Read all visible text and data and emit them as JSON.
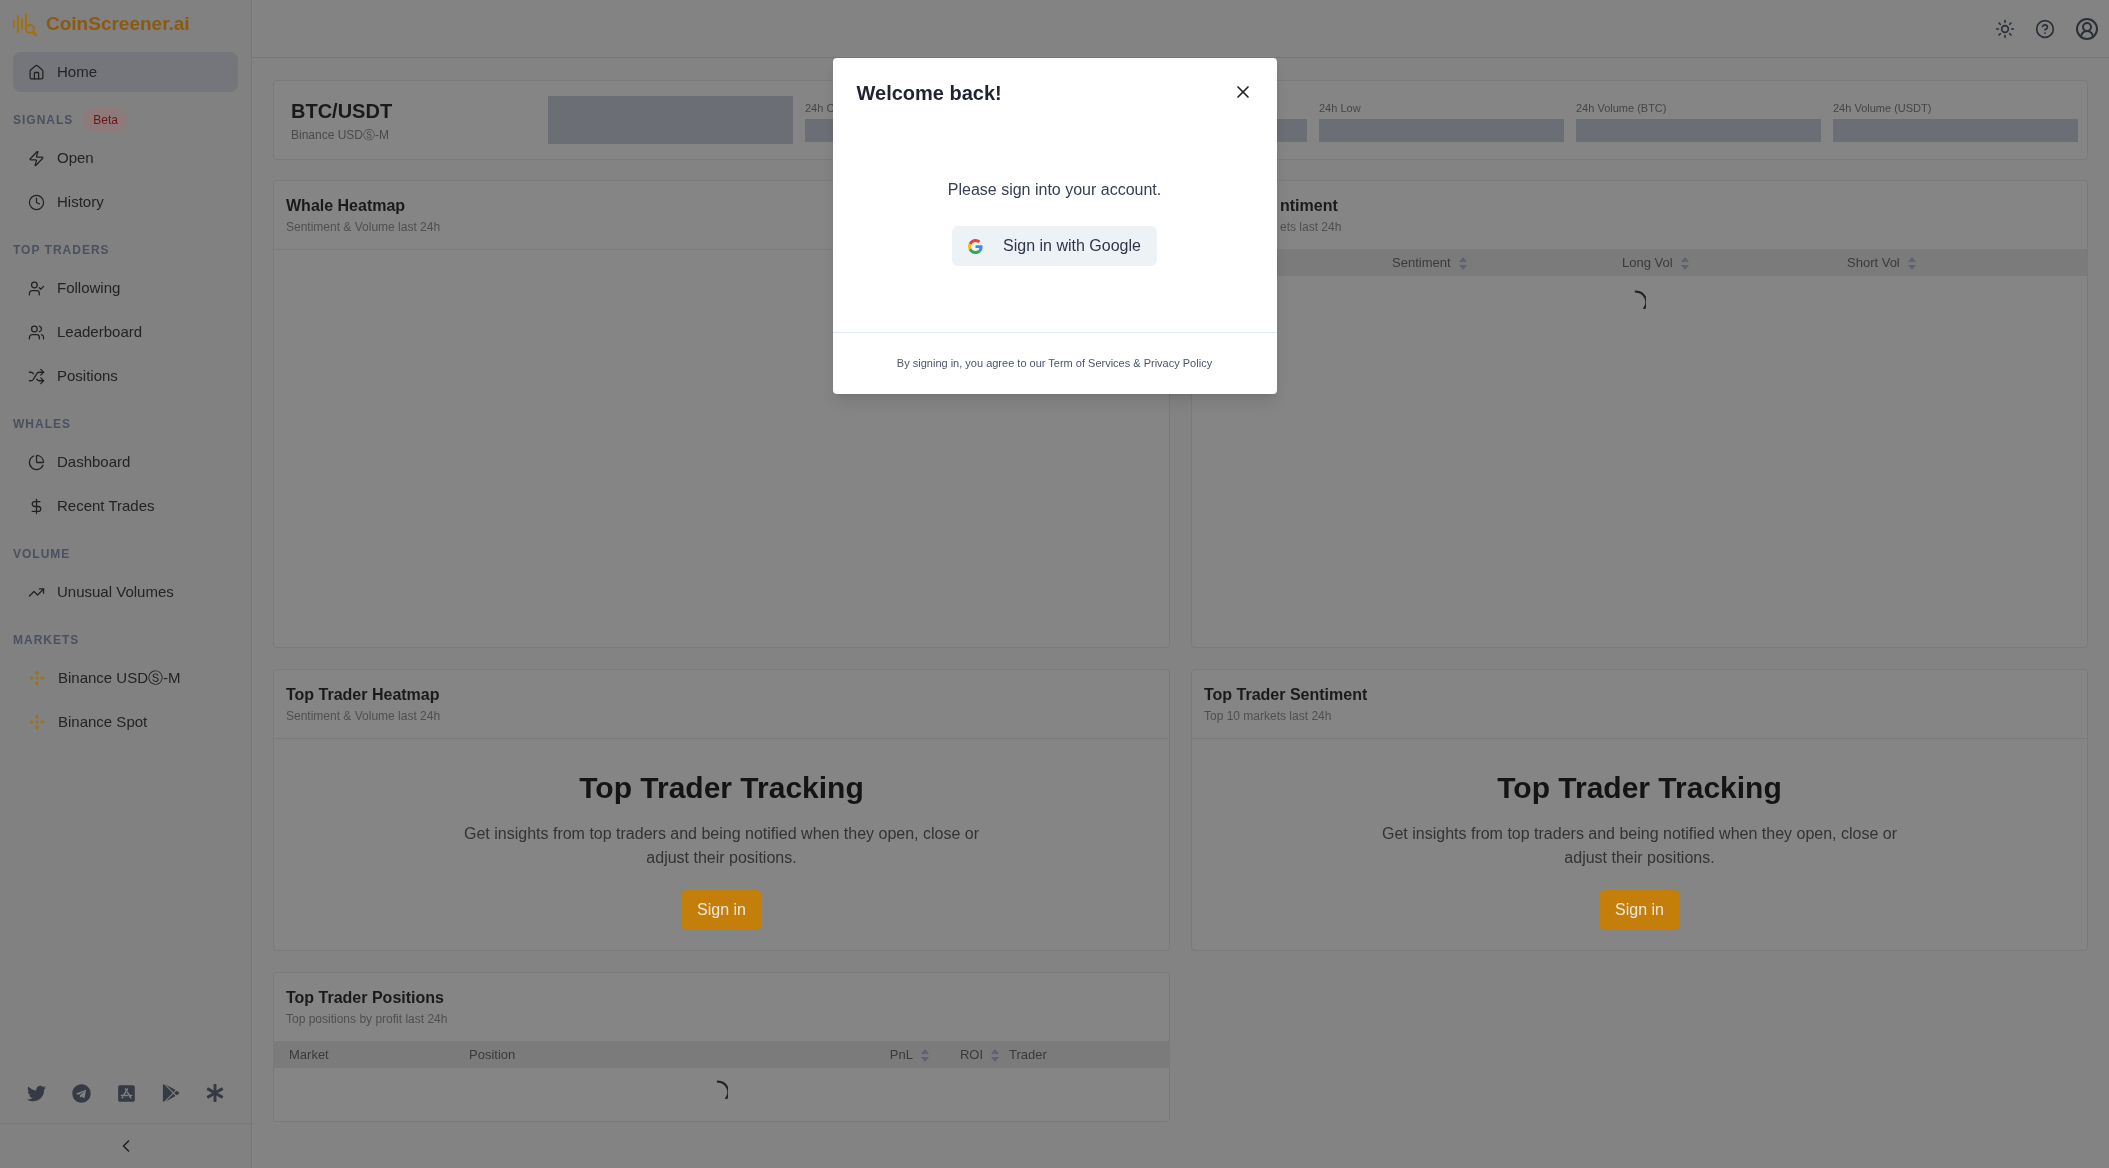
{
  "sidebar": {
    "logo": "CoinScreener.ai",
    "sections": [
      {
        "items": [
          {
            "label": "Home",
            "kind": "home",
            "selected": true
          }
        ]
      },
      {
        "title": "SIGNALS",
        "badge": "Beta",
        "items": [
          {
            "label": "Open",
            "kind": "zap",
            "selected": false
          },
          {
            "label": "History",
            "kind": "clock",
            "selected": false
          }
        ]
      },
      {
        "title": "TOP TRADERS",
        "items": [
          {
            "label": "Following",
            "kind": "user-check",
            "selected": false
          },
          {
            "label": "Leaderboard",
            "kind": "users",
            "selected": false
          },
          {
            "label": "Positions",
            "kind": "shuffle",
            "selected": false
          }
        ]
      },
      {
        "title": "WHALES",
        "items": [
          {
            "label": "Dashboard",
            "kind": "pie",
            "selected": false
          },
          {
            "label": "Recent Trades",
            "kind": "dollar",
            "selected": false
          }
        ]
      },
      {
        "title": "VOLUME",
        "items": [
          {
            "label": "Unusual Volumes",
            "kind": "trend",
            "selected": false
          }
        ]
      },
      {
        "title": "MARKETS",
        "items": [
          {
            "label": "Binance USDⓈ-M",
            "kind": "binance",
            "selected": false
          },
          {
            "label": "Binance Spot",
            "kind": "binance",
            "selected": false
          }
        ]
      }
    ]
  },
  "market": {
    "pair": "BTC/USDT",
    "exchange": "Binance USDⓈ-M",
    "stats": [
      {
        "label": "24h C"
      },
      {
        "label": "24h Low"
      },
      {
        "label": "24h Volume (BTC)"
      },
      {
        "label": "24h Volume (USDT)"
      }
    ]
  },
  "whale_heatmap": {
    "title": "Whale Heatmap",
    "subtitle": "Sentiment & Volume last 24h"
  },
  "sentiment_card": {
    "title": "ntiment",
    "subtitle": "ets last 24h",
    "columns": [
      {
        "label": "Sentiment",
        "sortable": true
      },
      {
        "label": "Long Vol",
        "sortable": true
      },
      {
        "label": "Short Vol",
        "sortable": true
      }
    ],
    "loading": true
  },
  "promo_cards": [
    {
      "title": "Top Trader Heatmap",
      "subtitle": "Sentiment & Volume last 24h",
      "heading": "Top Trader Tracking",
      "text": "Get insights from top traders and being notified when they open, close or adjust their positions.",
      "button": "Sign in"
    },
    {
      "title": "Top Trader Sentiment",
      "subtitle": "Top 10 markets last 24h",
      "heading": "Top Trader Tracking",
      "text": "Get insights from top traders and being notified when they open, close or adjust their positions.",
      "button": "Sign in"
    }
  ],
  "positions": {
    "title": "Top Trader Positions",
    "subtitle": "Top positions by profit last 24h",
    "columns": [
      {
        "label": "Market",
        "sortable": false
      },
      {
        "label": "Position",
        "sortable": false
      },
      {
        "label": "PnL",
        "sortable": true
      },
      {
        "label": "ROI",
        "sortable": true
      },
      {
        "label": "Trader",
        "sortable": false
      }
    ],
    "loading": true
  },
  "modal": {
    "title": "Welcome back!",
    "message": "Please sign into your account.",
    "button": "Sign in with Google",
    "footer": "By signing in, you agree to our Term of Services & Privacy Policy"
  }
}
